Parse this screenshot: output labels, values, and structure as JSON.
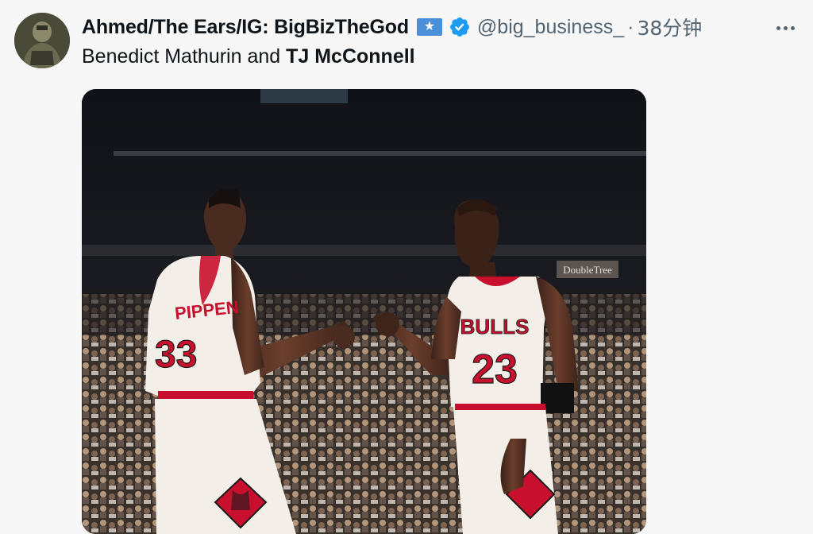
{
  "tweet": {
    "display_name": "Ahmed/The Ears/IG: BigBizTheGod",
    "handle": "@big_business_",
    "separator": "·",
    "time": "38分钟",
    "text_part1": "Benedict Mathurin and ",
    "text_mention": "TJ McConnell"
  },
  "photo": {
    "left_jersey_name": "PIPPEN",
    "left_jersey_number": "33",
    "right_jersey_team": "BULLS",
    "right_jersey_number": "23",
    "arena_sign": "DoubleTree"
  },
  "icons": {
    "flag": "somalia-flag-icon",
    "verified": "verified-badge-icon",
    "more": "more-options-icon"
  },
  "colors": {
    "verified_blue": "#1d9bf0",
    "flag_blue": "#4a8fd8",
    "secondary_text": "#536471",
    "bulls_red": "#c8102e"
  }
}
